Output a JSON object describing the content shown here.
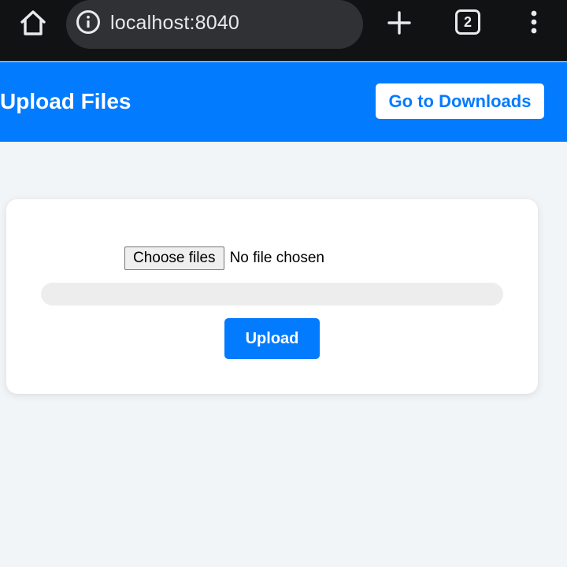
{
  "browser": {
    "url": "localhost:8040",
    "tab_count": "2",
    "icons": [
      "home-icon",
      "info-icon",
      "plus-icon",
      "tabs-icon",
      "more-vertical-icon"
    ]
  },
  "header": {
    "title": "Upload Files",
    "downloads_label": "Go to Downloads"
  },
  "upload": {
    "choose_label": "Choose files",
    "file_status": "No file chosen",
    "progress_percent": 0,
    "upload_label": "Upload"
  },
  "colors": {
    "accent": "#037bff",
    "page_background": "#f2f5f7",
    "chrome_background": "#111214",
    "url_pill": "#303134",
    "progress_track": "#ededed"
  }
}
